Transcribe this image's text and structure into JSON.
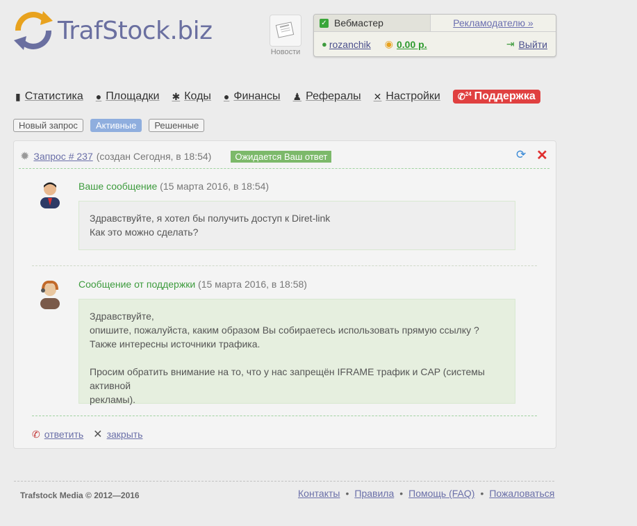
{
  "logo": {
    "text": "TrafStock.biz"
  },
  "news": {
    "label": "Новости"
  },
  "account": {
    "role": "Вебмастер",
    "advertiser_link": "Рекламодателю »",
    "username": "rozanchik",
    "balance": "0.00 р.",
    "logout": "Выйти"
  },
  "nav": {
    "stats": "Статистика",
    "sites": "Площадки",
    "codes": "Коды",
    "finance": "Финансы",
    "referrals": "Рефералы",
    "settings": "Настройки",
    "support": "Поддержка",
    "support_badge": "24"
  },
  "tabs": {
    "new": "Новый запрос",
    "active": "Активные",
    "resolved": "Решенные"
  },
  "request": {
    "link": "Запрос # 237",
    "created": "(создан Сегодня, в 18:54)",
    "status": "Ожидается Ваш ответ"
  },
  "messages": [
    {
      "author": "Ваше сообщение",
      "date": "(15 марта 2016, в 18:54)",
      "lines": [
        "Здравствуйте, я хотел бы получить доступ к Diret-link",
        "Как это можно сделать?"
      ]
    },
    {
      "author": "Сообщение от поддержки",
      "date": "(15 марта 2016, в 18:58)",
      "lines": [
        "Здравствуйте,",
        "опишите, пожалуйста, каким образом Вы собираетесь использовать прямую ссылку ?",
        "Также интересны источники трафика.",
        "",
        "Просим обратить внимание на то, что у нас запрещён IFRAME трафик и CAP (системы активной",
        "рекламы)."
      ]
    }
  ],
  "actions": {
    "reply": "ответить",
    "close": "закрыть"
  },
  "footer": {
    "copyright": "Trafstock Media © 2012—2016",
    "links": [
      "Контакты",
      "Правила",
      "Помощь (FAQ)",
      "Пожаловаться"
    ]
  },
  "colors": {
    "accent": "#e04040",
    "green": "#3d9b3d",
    "link": "#6a6fa8"
  }
}
